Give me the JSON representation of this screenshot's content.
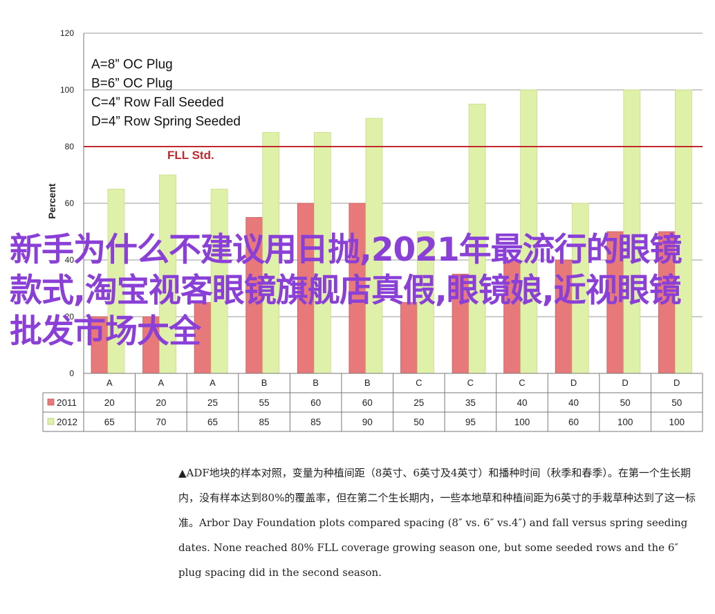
{
  "chart_data": {
    "type": "bar",
    "ylabel": "Percent",
    "ylim": [
      0,
      120
    ],
    "yticks": [
      0,
      20,
      40,
      60,
      80,
      100,
      120
    ],
    "grid": true,
    "categories": [
      "A",
      "A",
      "A",
      "B",
      "B",
      "B",
      "C",
      "C",
      "C",
      "D",
      "D",
      "D"
    ],
    "series": [
      {
        "name": "2011",
        "color": "#e8797b",
        "values": [
          20,
          20,
          25,
          55,
          60,
          60,
          25,
          35,
          40,
          40,
          50,
          50
        ]
      },
      {
        "name": "2012",
        "color": "#dff0a8",
        "values": [
          65,
          70,
          65,
          85,
          85,
          90,
          50,
          95,
          100,
          60,
          100,
          100
        ]
      }
    ],
    "reference_line": {
      "value": 80,
      "label": "FLL Std.",
      "color": "#c1272d"
    },
    "legend_notes": [
      "A=8” OC Plug",
      "B=6” OC Plug",
      "C=4” Row Fall Seeded",
      "D=4” Row Spring Seeded"
    ]
  },
  "headline": "新手为什么不建议用日抛,2021年最流行的眼镜款式,淘宝视客眼镜旗舰店真假,眼镜娘,近视眼镜批发市场大全",
  "caption": "▲ADF地块的样本对照，变量为种植间距（8英寸、6英寸及4英寸）和播种时间（秋季和春季）。在第一个生长期内，没有样本达到80%的覆盖率，但在第二个生长期内，一些本地草和种植间距为6英寸的手栽草种达到了这一标准。Arbor Day Foundation plots compared spacing (8″ vs. 6″ vs.4″) and fall versus spring seeding dates. None reached 80% FLL coverage growing season one, but some seeded rows and the 6″ plug spacing did in the second season."
}
